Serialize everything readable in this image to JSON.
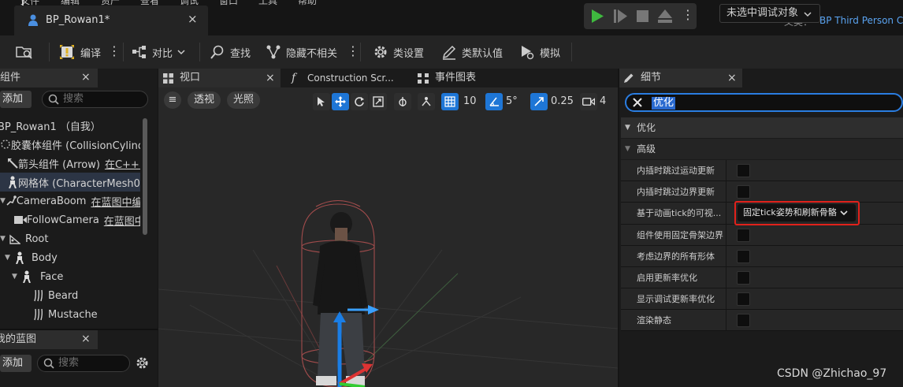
{
  "menu": {
    "items": [
      "文件",
      "编辑",
      "资产",
      "查看",
      "调试",
      "窗口",
      "工具",
      "帮助"
    ]
  },
  "document_tab": {
    "title": "BP_Rowan1*"
  },
  "parent": {
    "label": "父类：",
    "value": "BP Third Person Ch"
  },
  "toolbar": {
    "compile": "编译",
    "diff": "对比",
    "find": "查找",
    "hide_unrelated": "隐藏不相关",
    "class_settings": "类设置",
    "class_defaults": "类默认值",
    "simulate": "模拟",
    "debug_target": "未选中调试对象"
  },
  "components_panel": {
    "title": "组件",
    "add_label": "添加",
    "search_placeholder": "搜索",
    "items": [
      {
        "label": "BP_Rowan1 （自我）",
        "link": ""
      },
      {
        "label": "胶囊体组件 (CollisionCylind",
        "link": ""
      },
      {
        "label": "箭头组件 (Arrow)",
        "link": "在C++中"
      },
      {
        "label": "网格体 (CharacterMesh0)",
        "link": ""
      },
      {
        "label": "CameraBoom",
        "link": "在蓝图中编"
      },
      {
        "label": "FollowCamera",
        "link": "在蓝图中"
      },
      {
        "label": "Root",
        "link": ""
      },
      {
        "label": "Body",
        "link": ""
      },
      {
        "label": "Face",
        "link": ""
      },
      {
        "label": "Beard",
        "link": ""
      },
      {
        "label": "Mustache",
        "link": ""
      }
    ]
  },
  "my_blueprint_panel": {
    "title": "我的蓝图",
    "add_label": "添加",
    "search_placeholder": "搜索"
  },
  "editor_tabs": {
    "viewport": "视口",
    "construction_script": "Construction Scr...",
    "event_graph": "事件图表"
  },
  "viewport_toolbar": {
    "perspective": "透视",
    "lit": "光照",
    "grid_snap": "10",
    "rotation_snap": "5°",
    "scale_snap": "0.25",
    "camera_speed": "4"
  },
  "details_panel": {
    "title": "细节",
    "search_value": "优化",
    "category": "优化",
    "subcategory": "高级",
    "properties": [
      {
        "label": "内插时跳过运动更新",
        "type": "checkbox"
      },
      {
        "label": "内插时跳过边界更新",
        "type": "checkbox"
      },
      {
        "label": "基于动画tick的可视...",
        "type": "combo",
        "value": "固定tick姿势和刷新骨骼"
      },
      {
        "label": "组件使用固定骨架边界",
        "type": "checkbox"
      },
      {
        "label": "考虑边界的所有形体",
        "type": "checkbox"
      },
      {
        "label": "启用更新率优化",
        "type": "checkbox"
      },
      {
        "label": "显示调试更新率优化",
        "type": "checkbox"
      },
      {
        "label": "渲染静态",
        "type": "checkbox"
      }
    ]
  },
  "colors": {
    "accent": "#1e76d6",
    "highlight": "#e0211b",
    "play_green": "#3fb93f",
    "link_blue": "#5aa3f0"
  },
  "watermark": "CSDN @Zhichao_97"
}
